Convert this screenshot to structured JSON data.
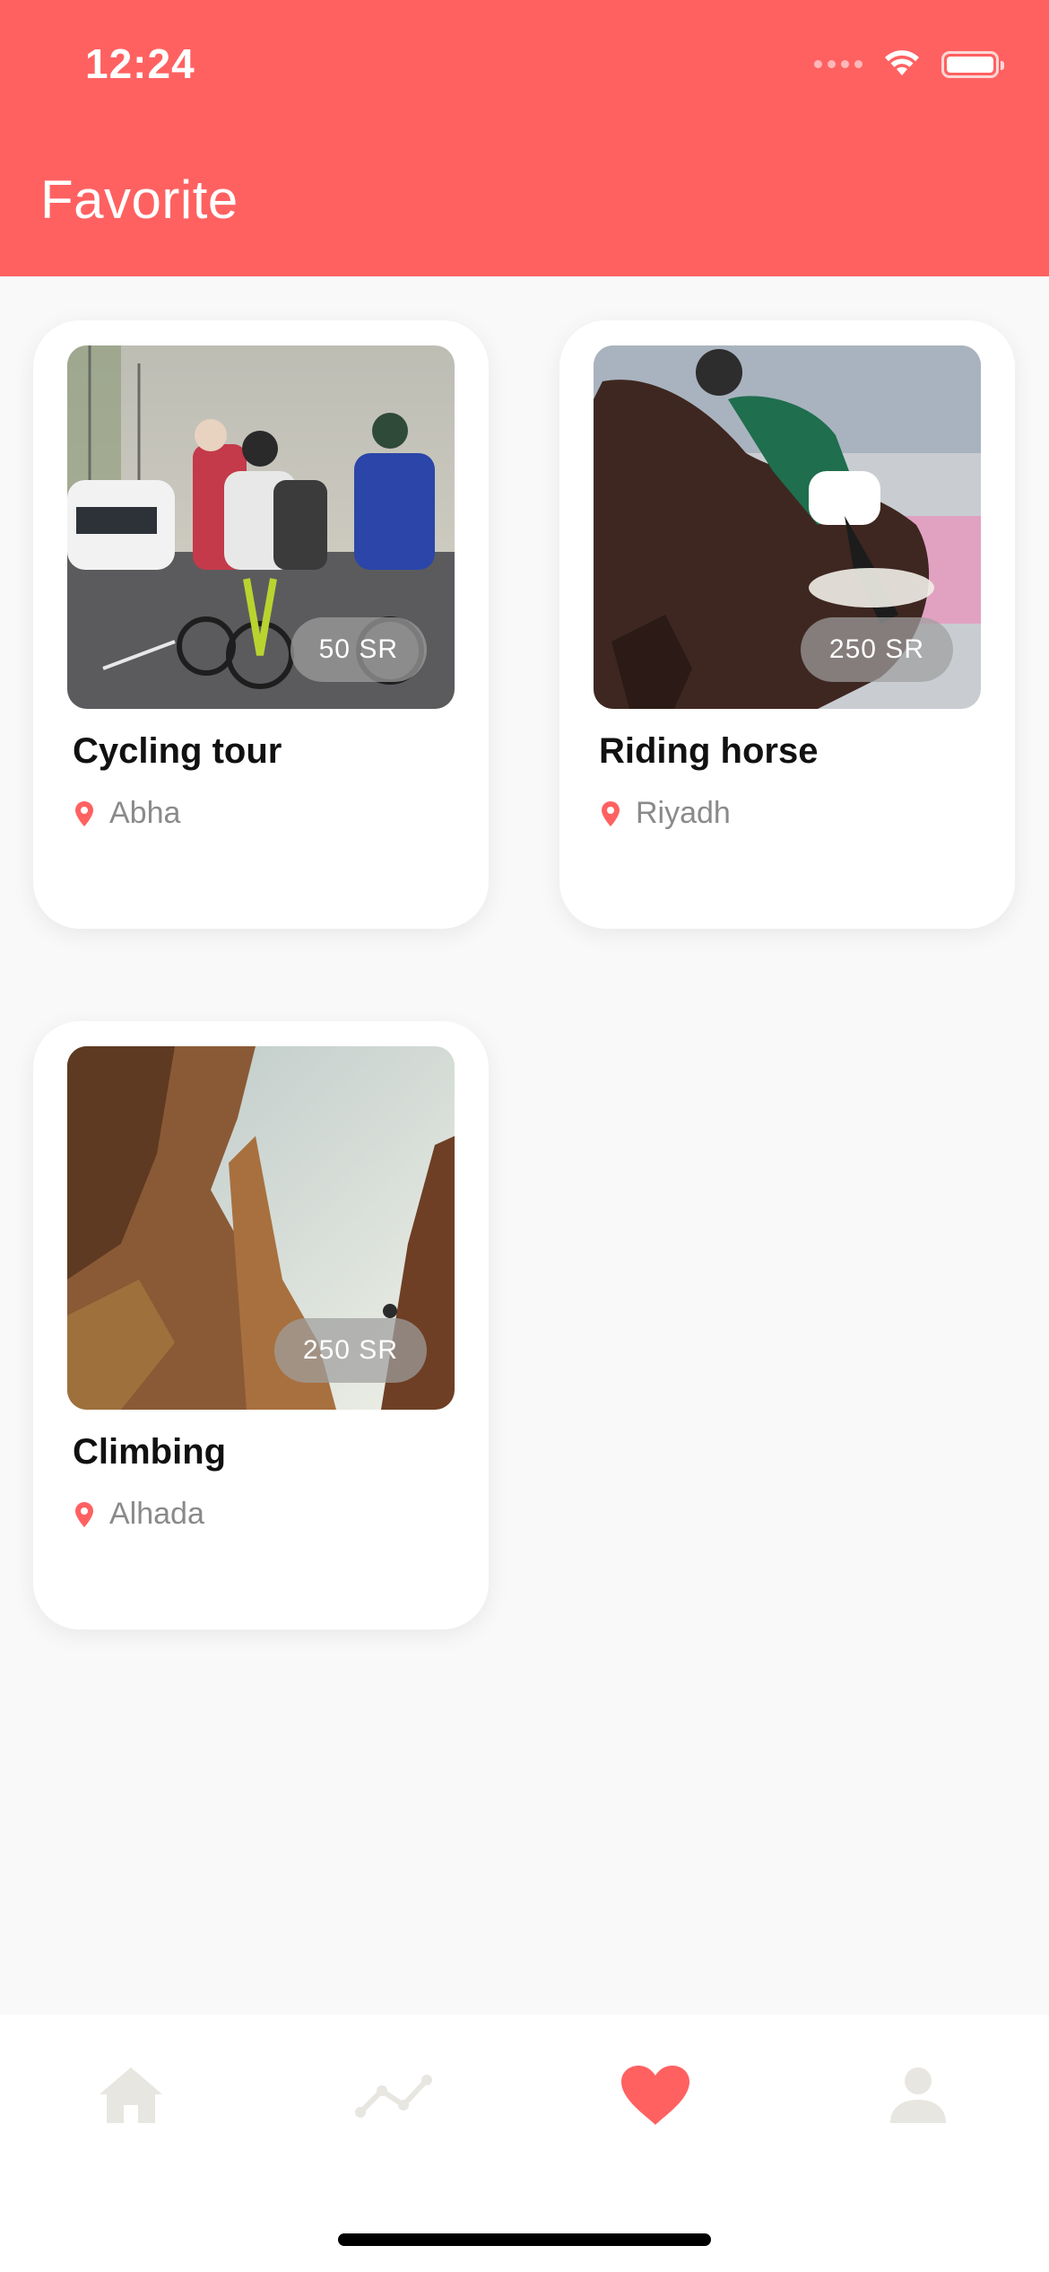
{
  "status_bar": {
    "time": "12:24"
  },
  "header": {
    "title": "Favorite",
    "background_color": "#ff6161"
  },
  "favorites": [
    {
      "title": "Cycling tour",
      "location": "Abha",
      "price": "50 SR",
      "image_icon": "cycling-photo"
    },
    {
      "title": "Riding horse",
      "location": "Riyadh",
      "price": "250 SR",
      "image_icon": "horse-riding-photo"
    },
    {
      "title": "Climbing",
      "location": "Alhada",
      "price": "250 SR",
      "image_icon": "climbing-photo"
    }
  ],
  "tab_bar": {
    "tabs": [
      {
        "name": "home",
        "icon": "home-icon",
        "active": false
      },
      {
        "name": "stats",
        "icon": "trend-icon",
        "active": false
      },
      {
        "name": "favorite",
        "icon": "heart-icon",
        "active": true
      },
      {
        "name": "profile",
        "icon": "person-icon",
        "active": false
      }
    ],
    "active_color": "#ff6161",
    "inactive_color": "#e8e6e0"
  }
}
